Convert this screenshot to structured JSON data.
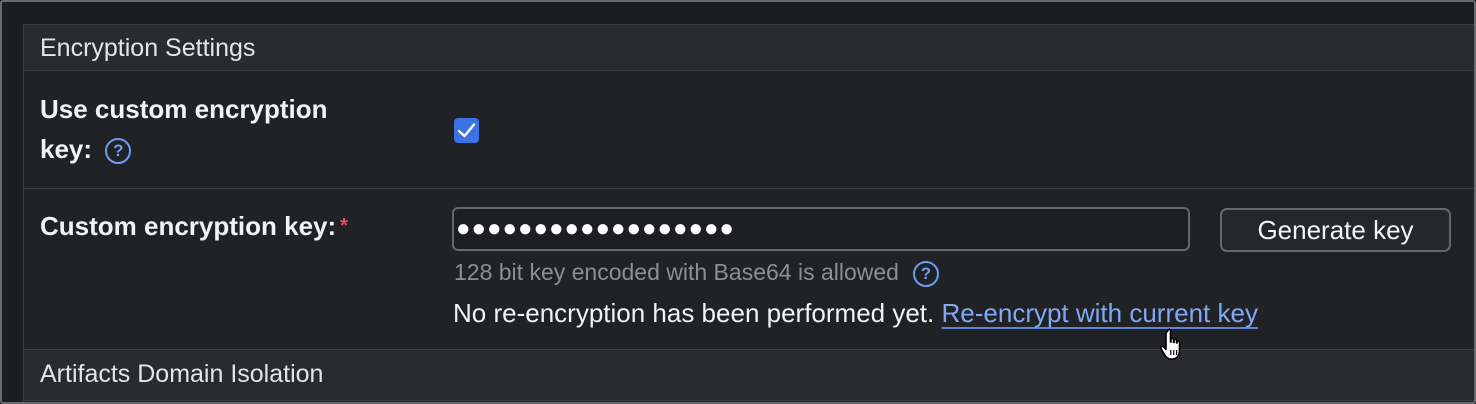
{
  "sections": {
    "encryption_settings": "Encryption Settings",
    "artifacts_domain_isolation": "Artifacts Domain Isolation"
  },
  "use_custom_key": {
    "label_line1": "Use custom encryption",
    "label_line2": "key:",
    "help_icon": "question-circle-icon",
    "checked": true
  },
  "custom_key": {
    "label": "Custom encryption key:",
    "required_mark": "*",
    "masked_value": "●●●●●●●●●●●●●●●●●●",
    "hint": "128 bit key encoded with Base64 is allowed",
    "generate_button": "Generate key",
    "status_text": "No re-encryption has been performed yet.",
    "reencrypt_link": "Re-encrypt with current key"
  },
  "colors": {
    "accent": "#3d72e4",
    "link": "#7fa9f5",
    "required": "#e0505a",
    "background": "#212226"
  }
}
